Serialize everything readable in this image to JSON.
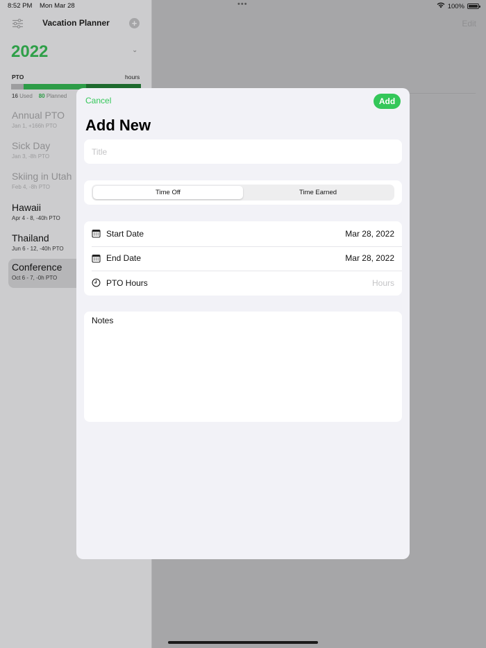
{
  "status_bar": {
    "time": "8:52 PM",
    "date": "Mon Mar 28",
    "dots": "•••",
    "battery": "100%"
  },
  "sidebar": {
    "title": "Vacation Planner",
    "add_icon": "plus-circle-icon",
    "year": "2022",
    "pto_label": "PTO",
    "hours_label": "hours",
    "bar": {
      "used": 16,
      "planned": 80,
      "total": 166
    },
    "legend": {
      "used_value": "16",
      "used_label": "Used",
      "planned_value": "80",
      "planned_label": "Planned"
    },
    "items": [
      {
        "name": "Annual PTO",
        "sub": "Jan 1, +166h PTO"
      },
      {
        "name": "Sick Day",
        "sub": "Jan 3, -8h PTO"
      },
      {
        "name": "Skiing in Utah",
        "sub": "Feb 4, -8h PTO"
      },
      {
        "name": "Hawaii",
        "sub": "Apr 4 - 8, -40h PTO"
      },
      {
        "name": "Thailand",
        "sub": "Jun 6 - 12, -40h PTO"
      },
      {
        "name": "Conference",
        "sub": "Oct 6 - 7, -0h PTO"
      }
    ]
  },
  "detail": {
    "edit_label": "Edit"
  },
  "sheet": {
    "cancel_label": "Cancel",
    "add_label": "Add",
    "title": "Add New",
    "title_placeholder": "Title",
    "segments": [
      "Time Off",
      "Time Earned"
    ],
    "selected_segment": "Time Off",
    "fields": {
      "start_label": "Start Date",
      "start_value": "Mar 28, 2022",
      "end_label": "End Date",
      "end_value": "Mar 28, 2022",
      "hours_label": "PTO Hours",
      "hours_placeholder": "Hours"
    },
    "notes_label": "Notes"
  },
  "colors": {
    "accent": "#34c759",
    "year_green": "#2e9f48",
    "bar_remaining": "#1e6a2e"
  }
}
